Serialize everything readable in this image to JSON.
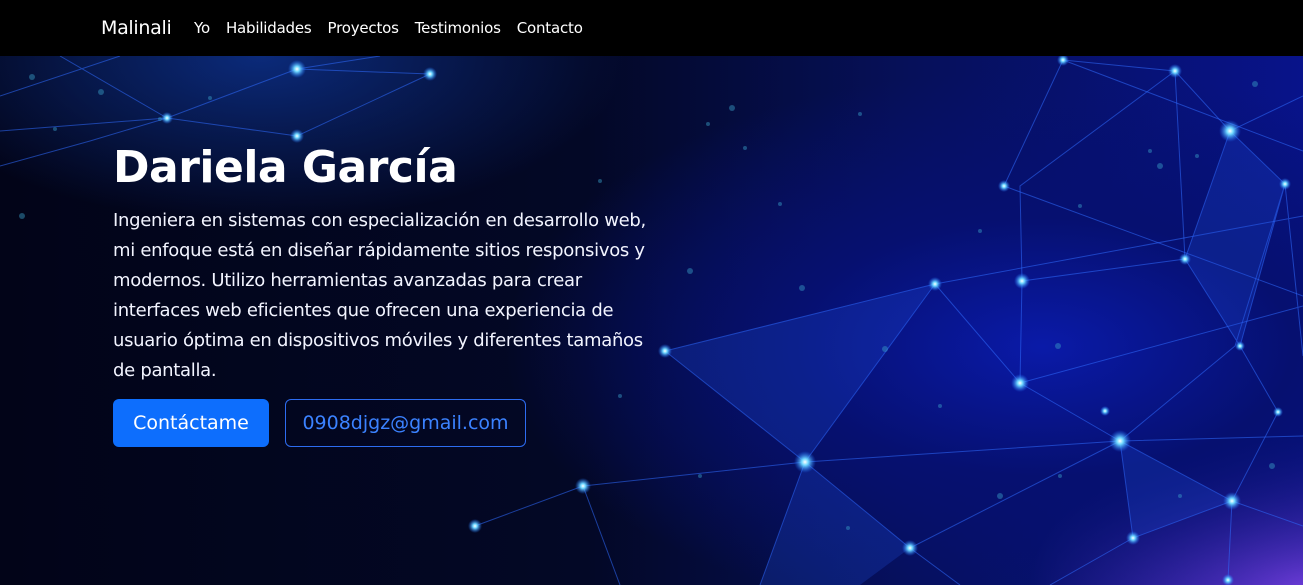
{
  "navbar": {
    "brand": "Malinali",
    "links": [
      "Yo",
      "Habilidades",
      "Proyectos",
      "Testimonios",
      "Contacto"
    ]
  },
  "hero": {
    "name": "Dariela García",
    "description": "Ingeniera en sistemas con especialización en desarrollo web, mi enfoque está en diseñar rápidamente sitios responsivos y modernos. Utilizo herramientas avanzadas para crear interfaces web eficientes que ofrecen una experiencia de usuario óptima en dispositivos móviles y diferentes tamaños de pantalla.",
    "contact_button": "Contáctame",
    "email_button": "0908djgz@gmail.com"
  },
  "colors": {
    "navbar_bg": "#000000",
    "primary": "#0d6efd",
    "outline": "#2d6cf0",
    "background": "#03051a"
  }
}
